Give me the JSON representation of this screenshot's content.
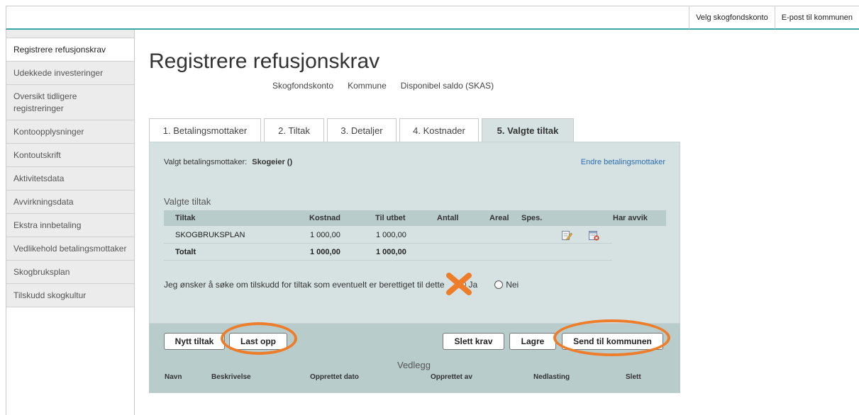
{
  "header": {
    "links": [
      "Velg skogfondskonto",
      "E-post til kommunen"
    ]
  },
  "sidebar": {
    "items": [
      {
        "label": "Registrere refusjonskrav",
        "active": true
      },
      {
        "label": "Udekkede investeringer"
      },
      {
        "label": "Oversikt tidligere registreringer"
      },
      {
        "label": "Kontoopplysninger"
      },
      {
        "label": "Kontoutskrift"
      },
      {
        "label": "Aktivitetsdata"
      },
      {
        "label": "Avvirkningsdata"
      },
      {
        "label": "Ekstra innbetaling"
      },
      {
        "label": "Vedlikehold betalingsmottaker"
      },
      {
        "label": "Skogbruksplan"
      },
      {
        "label": "Tilskudd skogkultur"
      }
    ]
  },
  "page": {
    "title": "Registrere refusjonskrav",
    "subinfo": [
      "Skogfondskonto",
      "Kommune",
      "Disponibel saldo (SKAS)"
    ]
  },
  "tabs": [
    {
      "label": "1. Betalingsmottaker"
    },
    {
      "label": "2. Tiltak"
    },
    {
      "label": "3. Detaljer"
    },
    {
      "label": "4. Kostnader"
    },
    {
      "label": "5. Valgte tiltak",
      "active": true
    }
  ],
  "panel": {
    "payee_label": "Valgt betalingsmottaker:",
    "payee_value": "Skogeier ()",
    "change_payee": "Endre betalingsmottaker",
    "section_title": "Valgte tiltak",
    "columns": {
      "tiltak": "Tiltak",
      "kostnad": "Kostnad",
      "til_utbet": "Til utbet",
      "antall": "Antall",
      "areal": "Areal",
      "spes": "Spes.",
      "har_avvik": "Har avvik"
    },
    "rows": [
      {
        "tiltak": "SKOGBRUKSPLAN",
        "kostnad": "1 000,00",
        "til_utbet": "1 000,00"
      }
    ],
    "total": {
      "label": "Totalt",
      "kostnad": "1 000,00",
      "til_utbet": "1 000,00"
    },
    "question": "Jeg ønsker å søke om tilskudd for tiltak som eventuelt er berettiget til dette",
    "option_yes": "Ja",
    "option_no": "Nei"
  },
  "buttons": {
    "new": "Nytt tiltak",
    "upload": "Last opp",
    "delete": "Slett krav",
    "save": "Lagre",
    "send": "Send til kommunen"
  },
  "attachments": {
    "title": "Vedlegg",
    "columns": [
      "Navn",
      "Beskrivelse",
      "Opprettet dato",
      "Opprettet av",
      "Nedlasting",
      "Slett"
    ]
  },
  "colors": {
    "highlight": "#ee7d2a",
    "panel": "#d6e2e2",
    "accent": "#3aa6a6"
  }
}
